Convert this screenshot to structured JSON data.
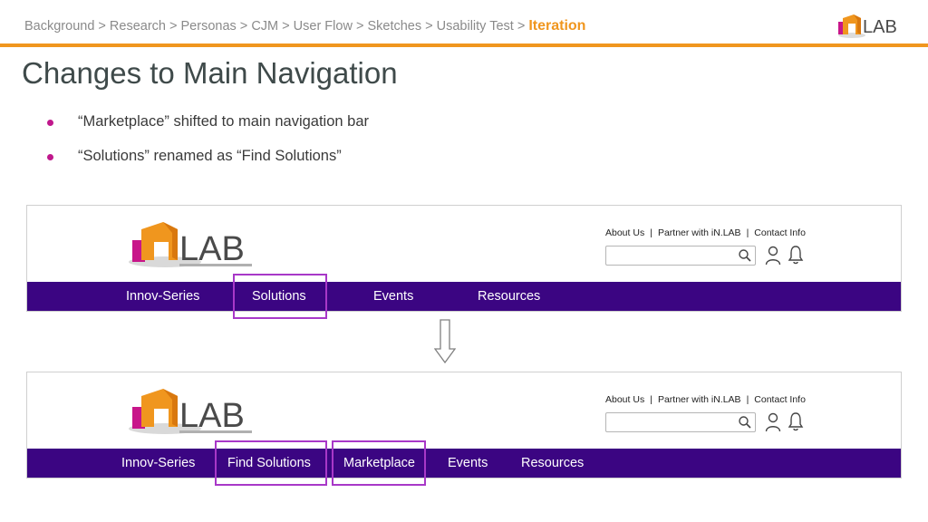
{
  "breadcrumb": {
    "items": [
      "Background",
      "Research",
      "Personas",
      "CJM",
      "User Flow",
      "Sketches",
      "Usability Test"
    ],
    "separator": " > ",
    "current": "Iteration"
  },
  "page_title": "Changes to Main Navigation",
  "bullets": [
    "“Marketplace” shifted to main navigation bar",
    "“Solutions” renamed as “Find Solutions”"
  ],
  "before": {
    "toplinks": [
      "About Us",
      "Partner with iN.LAB",
      "Contact Info"
    ],
    "nav": [
      "Innov-Series",
      "Solutions",
      "Events",
      "Resources"
    ],
    "highlighted": [
      "Solutions"
    ]
  },
  "after": {
    "toplinks": [
      "About Us",
      "Partner with iN.LAB",
      "Contact Info"
    ],
    "nav": [
      "Innov-Series",
      "Find Solutions",
      "Marketplace",
      "Events",
      "Resources"
    ],
    "highlighted": [
      "Find Solutions",
      "Marketplace"
    ]
  },
  "logo_text": "LAB",
  "icons": [
    "search-icon",
    "user-icon",
    "bell-icon",
    "down-arrow-icon"
  ],
  "colors": {
    "accent_orange": "#f0961e",
    "nav_purple": "#3b0582",
    "highlight_violet": "#a838c8",
    "bullet_magenta": "#c0188c",
    "logo_magenta": "#c8168a",
    "logo_grey": "#4a4a4a"
  }
}
